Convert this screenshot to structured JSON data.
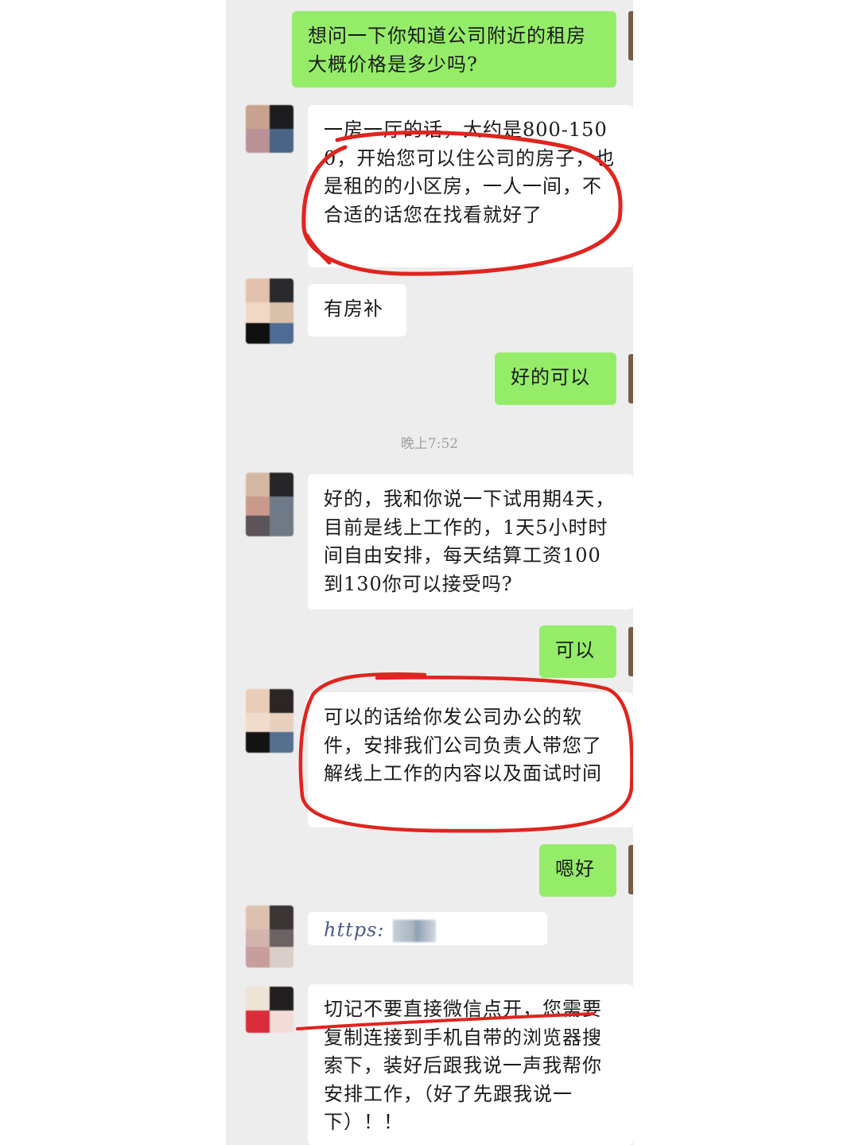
{
  "chat": {
    "timestamp": "晚上7:52",
    "messages": [
      {
        "side": "out",
        "text": "想问一下你知道公司附近的租房大概价格是多少吗?"
      },
      {
        "side": "in",
        "text": "一房一厅的话，大约是800-1500，开始您可以住公司的房子，也是租的的小区房，一人一间，不合适的话您在找看就好了"
      },
      {
        "side": "in",
        "text": "有房补"
      },
      {
        "side": "out",
        "text": "好的可以"
      },
      {
        "side": "in",
        "text": "好的，我和你说一下试用期4天，目前是线上工作的，1天5小时时间自由安排，每天结算工资100到130你可以接受吗?"
      },
      {
        "side": "out",
        "text": "可以"
      },
      {
        "side": "in",
        "text": "可以的话给你发公司办公的软件，安排我们公司负责人带您了解线上工作的内容以及面试时间"
      },
      {
        "side": "out",
        "text": "嗯好"
      },
      {
        "side": "in",
        "text": "https:"
      },
      {
        "side": "in",
        "text": "切记不要直接微信点开，您需要复制连接到手机自带的浏览器搜索下，装好后跟我说一声我帮你安排工作，（好了先跟我说一下）！！"
      }
    ]
  },
  "colors": {
    "outgoing_bubble": "#95ec69",
    "incoming_bubble": "#ffffff",
    "chat_background": "#ededed",
    "annotation_ink": "#e0241f"
  }
}
